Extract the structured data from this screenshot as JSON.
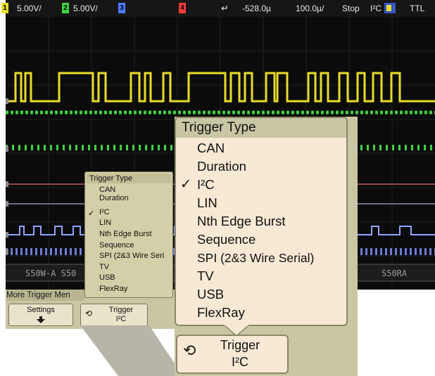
{
  "status_bar": {
    "ch1_label": "1",
    "ch1_scale": "5.00V/",
    "ch2_label": "2",
    "ch2_scale": "5.00V/",
    "ch3_label": "3",
    "ch4_label": "4",
    "trigger_delay": "-528.0µ",
    "time_base": "100.0µ/",
    "run_state": "Stop",
    "trigger_mode": "I²C",
    "trigger_level": "TTL",
    "colors": {
      "ch1": "#e8dc2a",
      "ch2": "#3fd13f",
      "ch3": "#4a7bff",
      "ch4": "#ff3b3b"
    }
  },
  "display": {
    "bus_labels": [
      "S50W-A S50",
      "S50RA"
    ]
  },
  "softkeys": {
    "more_trigger_menu_label": "More Trigger Men",
    "settings_label": "Settings",
    "settings_icon": "down-arrow-icon",
    "trigger_label": "Trigger",
    "trigger_value": "I²C",
    "trigger_icon": "rotary-knob-icon"
  },
  "trigger_type_menu": {
    "title": "Trigger Type",
    "selected": "I²C",
    "items": [
      "CAN",
      "Duration",
      "I²C",
      "LIN",
      "Nth Edge Burst",
      "Sequence",
      "SPI (2&3 Wire Serial)",
      "TV",
      "USB",
      "FlexRay"
    ]
  },
  "small_menu": {
    "title": "Trigger Type",
    "items": [
      "CAN",
      "Duration",
      "I²C",
      "LIN",
      "Nth Edge Burst",
      "Sequence",
      "SPI (2&3 Wire Seri",
      "TV",
      "USB",
      "FlexRay"
    ]
  }
}
